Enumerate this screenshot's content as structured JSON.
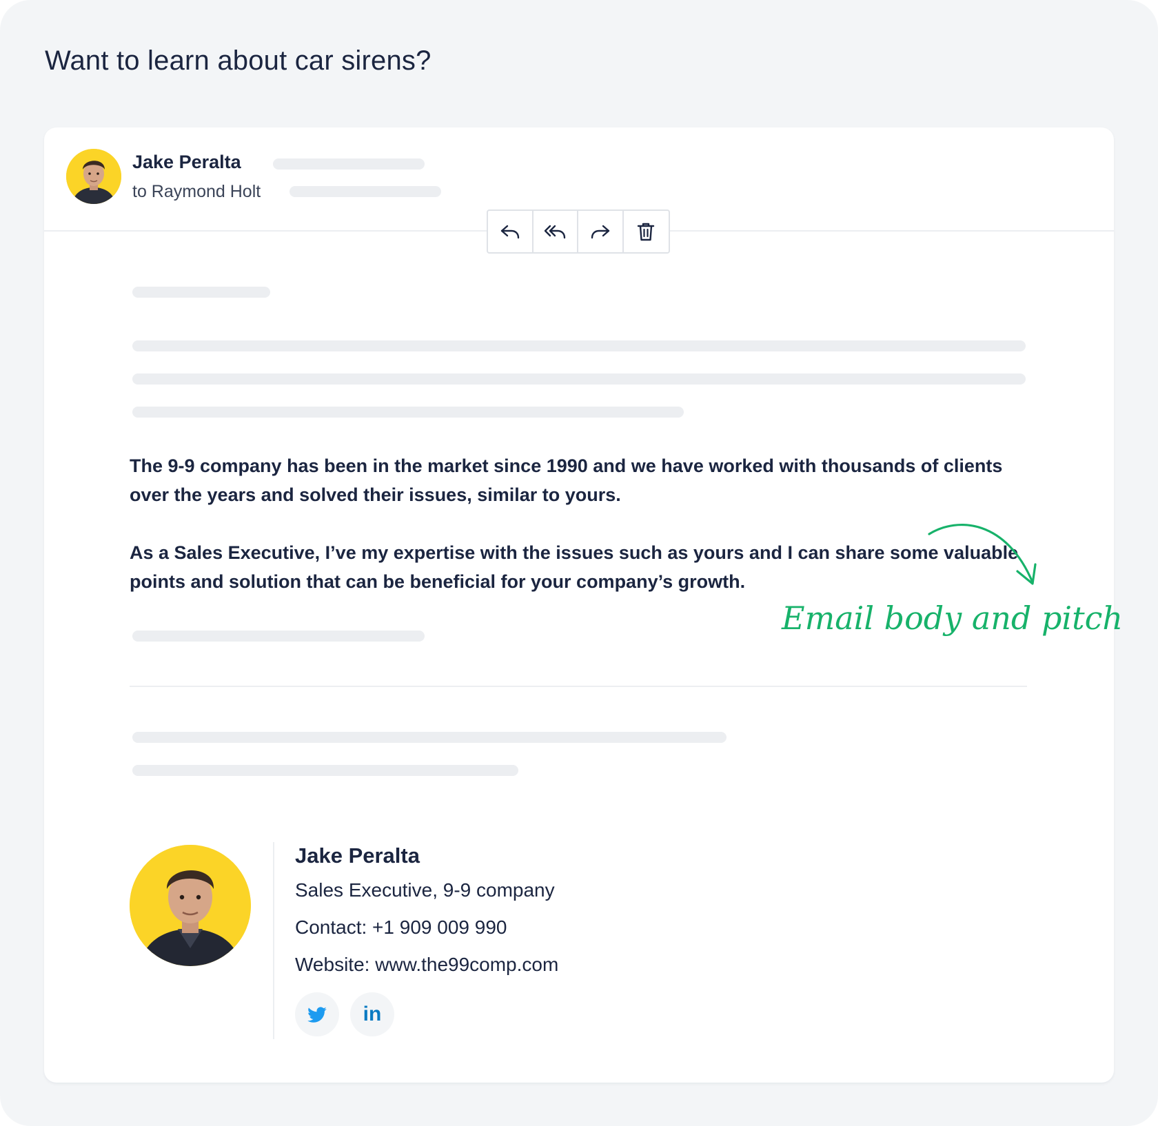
{
  "page": {
    "title": "Want to learn about car sirens?"
  },
  "email": {
    "sender_name": "Jake Peralta",
    "recipient_line": "to Raymond Holt",
    "toolbar": {
      "icons": [
        "reply-icon",
        "reply-all-icon",
        "forward-icon",
        "trash-icon"
      ]
    },
    "body": {
      "paragraph_1": "The 9-9 company has been in the market since 1990 and we have worked with thousands of clients over the years and solved their issues, similar to yours.",
      "paragraph_2": "As a Sales Executive, I’ve my expertise with the issues such as yours and I can share some valuable points and solution that can be beneficial for your company’s growth."
    },
    "annotation": {
      "text": "Email body and pitch",
      "color": "#17b26a"
    },
    "signature": {
      "name": "Jake Peralta",
      "title": "Sales Executive, 9-9 company",
      "contact": "Contact: +1 909 009 990",
      "website": "Website: www.the99comp.com",
      "social": [
        {
          "icon": "twitter-icon",
          "color": "#1d9bf0"
        },
        {
          "icon": "linkedin-icon",
          "label": "in",
          "color": "#0a7ac2"
        }
      ]
    }
  },
  "colors": {
    "background": "#f3f5f7",
    "card": "#ffffff",
    "text": "#1b2540",
    "placeholder": "#eceef1",
    "avatar_bg": "#fbd427"
  }
}
